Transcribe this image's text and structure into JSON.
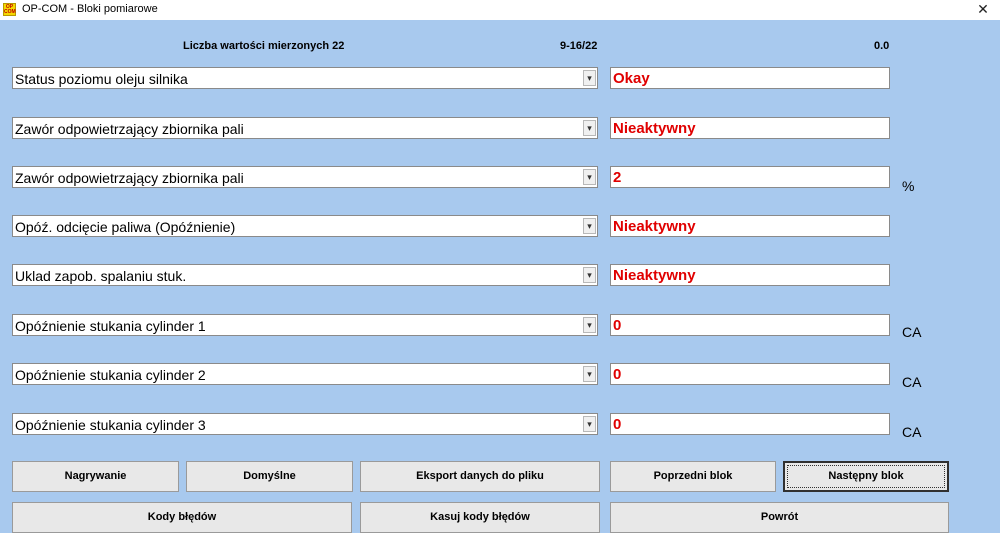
{
  "window": {
    "app_icon_text": "OP\nCOM",
    "title": "OP-COM - Bloki pomiarowe",
    "close_glyph": "✕"
  },
  "header": {
    "count_label": "Liczba wartości mierzonych 22",
    "range": "9-16/22",
    "time": "0.0"
  },
  "rows": [
    {
      "label": "Status poziomu oleju silnika",
      "value": "Okay",
      "unit": ""
    },
    {
      "label": "Zawór odpowietrzający zbiornika pali",
      "value": "Nieaktywny",
      "unit": ""
    },
    {
      "label": "Zawór odpowietrzający zbiornika pali",
      "value": "2",
      "unit": "%"
    },
    {
      "label": "Opóź. odcięcie paliwa (Opóźnienie)",
      "value": "Nieaktywny",
      "unit": ""
    },
    {
      "label": "Uklad zapob. spalaniu stuk.",
      "value": "Nieaktywny",
      "unit": ""
    },
    {
      "label": "Opóźnienie stukania cylinder 1",
      "value": "0",
      "unit": "CA"
    },
    {
      "label": "Opóźnienie stukania cylinder 2",
      "value": "0",
      "unit": "CA"
    },
    {
      "label": "Opóźnienie stukania cylinder 3",
      "value": "0",
      "unit": "CA"
    }
  ],
  "dropdown_arrow_glyph": "▾",
  "buttons": {
    "record": "Nagrywanie",
    "defaults": "Domyślne",
    "export": "Eksport danych do pliku",
    "prev_block": "Poprzedni blok",
    "next_block": "Następny blok",
    "error_codes": "Kody błędów",
    "clear_error_codes": "Kasuj kody błędów",
    "back": "Powrót"
  },
  "colors": {
    "background": "#a8c9ee",
    "value_text": "#e00000"
  }
}
